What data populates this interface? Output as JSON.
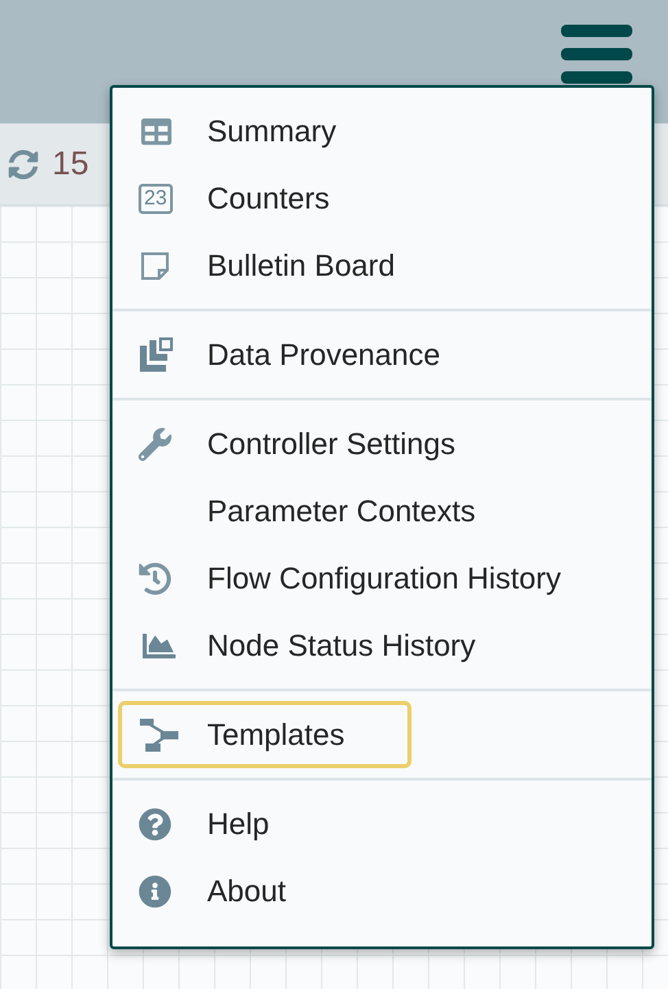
{
  "toolbar": {
    "time": "15"
  },
  "menu": {
    "sections": [
      {
        "items": [
          {
            "label": "Summary",
            "kind": "table",
            "selected": false
          },
          {
            "label": "Counters",
            "kind": "counter",
            "badge": "23",
            "selected": false
          },
          {
            "label": "Bulletin Board",
            "kind": "note",
            "selected": false
          }
        ]
      },
      {
        "items": [
          {
            "label": "Data Provenance",
            "kind": "provenance",
            "selected": false
          }
        ]
      },
      {
        "items": [
          {
            "label": "Controller Settings",
            "kind": "wrench",
            "selected": false
          },
          {
            "label": "Parameter Contexts",
            "kind": "plain",
            "selected": false
          },
          {
            "label": "Flow Configuration History",
            "kind": "history",
            "selected": false
          },
          {
            "label": "Node Status History",
            "kind": "area",
            "selected": false
          }
        ]
      },
      {
        "items": [
          {
            "label": "Templates",
            "kind": "templates",
            "selected": true
          }
        ]
      },
      {
        "items": [
          {
            "label": "Help",
            "kind": "help",
            "selected": false
          },
          {
            "label": "About",
            "kind": "info",
            "selected": false
          }
        ]
      }
    ]
  }
}
